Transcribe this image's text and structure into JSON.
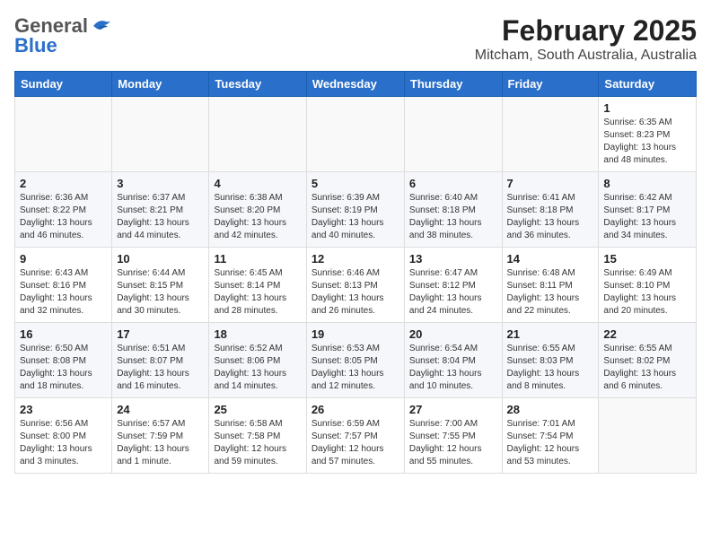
{
  "header": {
    "logo": {
      "general": "General",
      "blue": "Blue"
    },
    "title": "February 2025",
    "subtitle": "Mitcham, South Australia, Australia"
  },
  "weekdays": [
    "Sunday",
    "Monday",
    "Tuesday",
    "Wednesday",
    "Thursday",
    "Friday",
    "Saturday"
  ],
  "weeks": [
    [
      {
        "day": "",
        "info": ""
      },
      {
        "day": "",
        "info": ""
      },
      {
        "day": "",
        "info": ""
      },
      {
        "day": "",
        "info": ""
      },
      {
        "day": "",
        "info": ""
      },
      {
        "day": "",
        "info": ""
      },
      {
        "day": "1",
        "info": "Sunrise: 6:35 AM\nSunset: 8:23 PM\nDaylight: 13 hours\nand 48 minutes."
      }
    ],
    [
      {
        "day": "2",
        "info": "Sunrise: 6:36 AM\nSunset: 8:22 PM\nDaylight: 13 hours\nand 46 minutes."
      },
      {
        "day": "3",
        "info": "Sunrise: 6:37 AM\nSunset: 8:21 PM\nDaylight: 13 hours\nand 44 minutes."
      },
      {
        "day": "4",
        "info": "Sunrise: 6:38 AM\nSunset: 8:20 PM\nDaylight: 13 hours\nand 42 minutes."
      },
      {
        "day": "5",
        "info": "Sunrise: 6:39 AM\nSunset: 8:19 PM\nDaylight: 13 hours\nand 40 minutes."
      },
      {
        "day": "6",
        "info": "Sunrise: 6:40 AM\nSunset: 8:18 PM\nDaylight: 13 hours\nand 38 minutes."
      },
      {
        "day": "7",
        "info": "Sunrise: 6:41 AM\nSunset: 8:18 PM\nDaylight: 13 hours\nand 36 minutes."
      },
      {
        "day": "8",
        "info": "Sunrise: 6:42 AM\nSunset: 8:17 PM\nDaylight: 13 hours\nand 34 minutes."
      }
    ],
    [
      {
        "day": "9",
        "info": "Sunrise: 6:43 AM\nSunset: 8:16 PM\nDaylight: 13 hours\nand 32 minutes."
      },
      {
        "day": "10",
        "info": "Sunrise: 6:44 AM\nSunset: 8:15 PM\nDaylight: 13 hours\nand 30 minutes."
      },
      {
        "day": "11",
        "info": "Sunrise: 6:45 AM\nSunset: 8:14 PM\nDaylight: 13 hours\nand 28 minutes."
      },
      {
        "day": "12",
        "info": "Sunrise: 6:46 AM\nSunset: 8:13 PM\nDaylight: 13 hours\nand 26 minutes."
      },
      {
        "day": "13",
        "info": "Sunrise: 6:47 AM\nSunset: 8:12 PM\nDaylight: 13 hours\nand 24 minutes."
      },
      {
        "day": "14",
        "info": "Sunrise: 6:48 AM\nSunset: 8:11 PM\nDaylight: 13 hours\nand 22 minutes."
      },
      {
        "day": "15",
        "info": "Sunrise: 6:49 AM\nSunset: 8:10 PM\nDaylight: 13 hours\nand 20 minutes."
      }
    ],
    [
      {
        "day": "16",
        "info": "Sunrise: 6:50 AM\nSunset: 8:08 PM\nDaylight: 13 hours\nand 18 minutes."
      },
      {
        "day": "17",
        "info": "Sunrise: 6:51 AM\nSunset: 8:07 PM\nDaylight: 13 hours\nand 16 minutes."
      },
      {
        "day": "18",
        "info": "Sunrise: 6:52 AM\nSunset: 8:06 PM\nDaylight: 13 hours\nand 14 minutes."
      },
      {
        "day": "19",
        "info": "Sunrise: 6:53 AM\nSunset: 8:05 PM\nDaylight: 13 hours\nand 12 minutes."
      },
      {
        "day": "20",
        "info": "Sunrise: 6:54 AM\nSunset: 8:04 PM\nDaylight: 13 hours\nand 10 minutes."
      },
      {
        "day": "21",
        "info": "Sunrise: 6:55 AM\nSunset: 8:03 PM\nDaylight: 13 hours\nand 8 minutes."
      },
      {
        "day": "22",
        "info": "Sunrise: 6:55 AM\nSunset: 8:02 PM\nDaylight: 13 hours\nand 6 minutes."
      }
    ],
    [
      {
        "day": "23",
        "info": "Sunrise: 6:56 AM\nSunset: 8:00 PM\nDaylight: 13 hours\nand 3 minutes."
      },
      {
        "day": "24",
        "info": "Sunrise: 6:57 AM\nSunset: 7:59 PM\nDaylight: 13 hours\nand 1 minute."
      },
      {
        "day": "25",
        "info": "Sunrise: 6:58 AM\nSunset: 7:58 PM\nDaylight: 12 hours\nand 59 minutes."
      },
      {
        "day": "26",
        "info": "Sunrise: 6:59 AM\nSunset: 7:57 PM\nDaylight: 12 hours\nand 57 minutes."
      },
      {
        "day": "27",
        "info": "Sunrise: 7:00 AM\nSunset: 7:55 PM\nDaylight: 12 hours\nand 55 minutes."
      },
      {
        "day": "28",
        "info": "Sunrise: 7:01 AM\nSunset: 7:54 PM\nDaylight: 12 hours\nand 53 minutes."
      },
      {
        "day": "",
        "info": ""
      }
    ]
  ]
}
